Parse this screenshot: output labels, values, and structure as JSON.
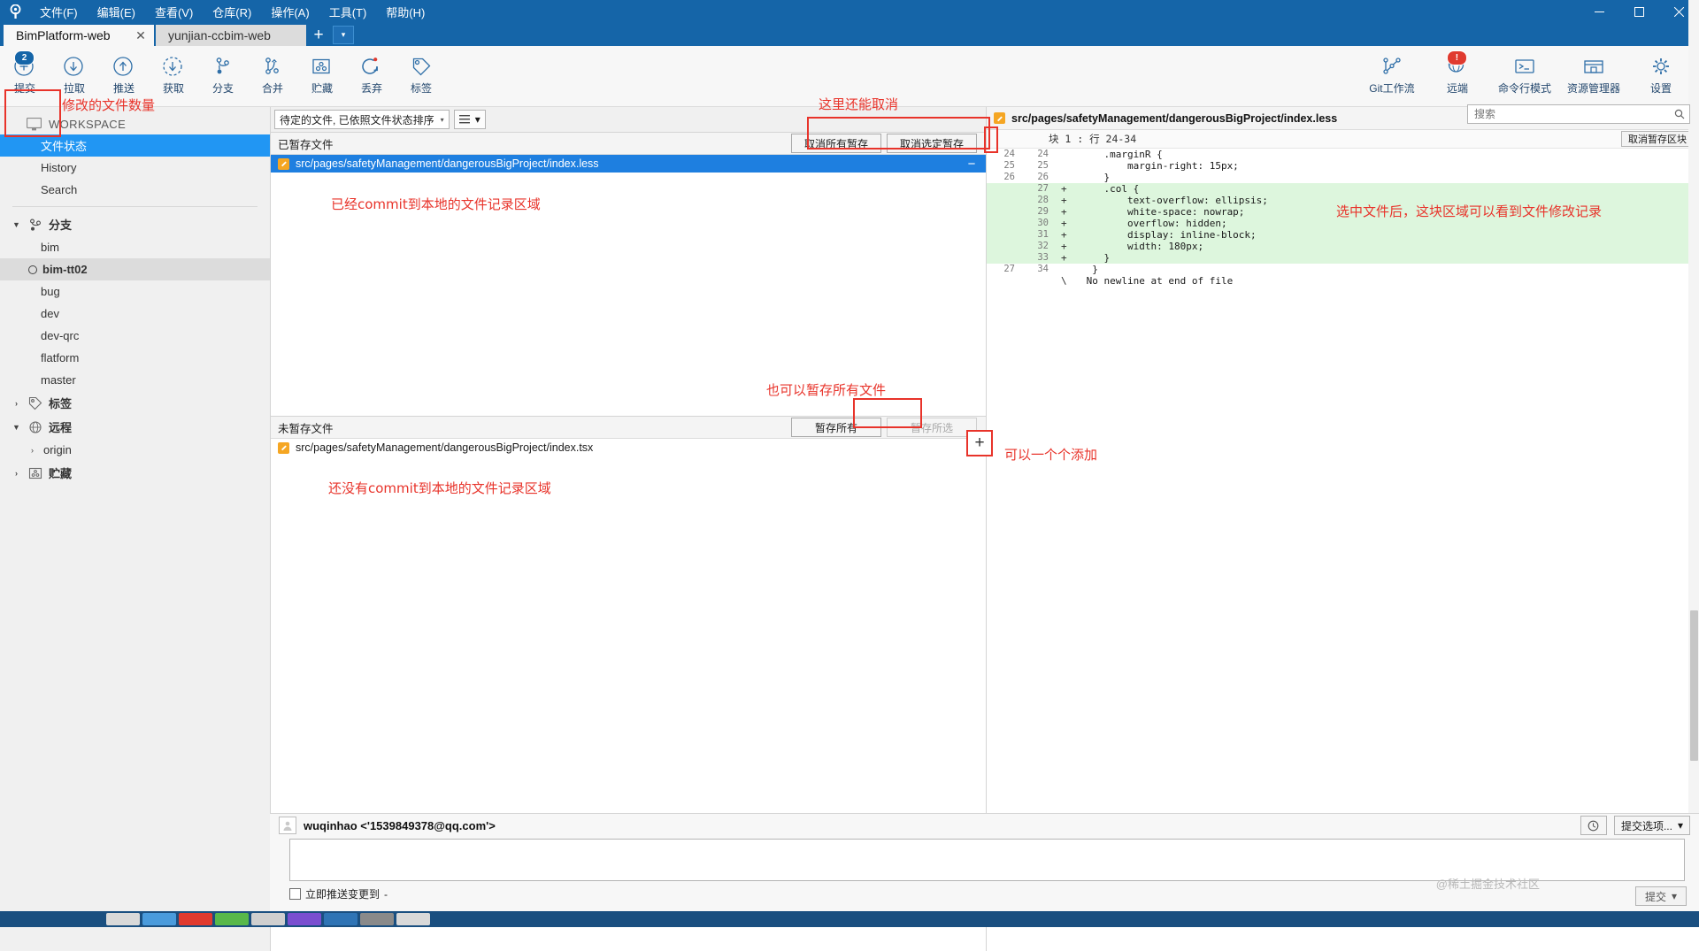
{
  "window": {
    "menus": [
      "文件(F)",
      "编辑(E)",
      "查看(V)",
      "仓库(R)",
      "操作(A)",
      "工具(T)",
      "帮助(H)"
    ],
    "controls": {
      "minimize": "minimize-icon",
      "maximize": "maximize-icon",
      "close": "close-icon"
    }
  },
  "tabs": {
    "items": [
      {
        "label": "BimPlatform-web",
        "active": true,
        "closable": true
      },
      {
        "label": "yunjian-ccbim-web",
        "active": false,
        "closable": false
      }
    ],
    "add_label": "+",
    "dropdown_label": "▾"
  },
  "toolbar": {
    "left": [
      {
        "label": "提交",
        "icon": "commit-plus-icon",
        "badge": "2",
        "badge_color": "#1565a8"
      },
      {
        "label": "拉取",
        "icon": "pull-down-icon",
        "badge": ""
      },
      {
        "label": "推送",
        "icon": "push-up-icon",
        "badge": ""
      },
      {
        "label": "获取",
        "icon": "fetch-dashed-icon",
        "badge": ""
      },
      {
        "label": "分支",
        "icon": "branch-icon",
        "badge": ""
      },
      {
        "label": "合并",
        "icon": "merge-icon",
        "badge": ""
      },
      {
        "label": "贮藏",
        "icon": "stash-icon",
        "badge": ""
      },
      {
        "label": "丢弃",
        "icon": "discard-refresh-icon",
        "badge": ""
      },
      {
        "label": "标签",
        "icon": "tag-icon",
        "badge": ""
      }
    ],
    "right": [
      {
        "label": "Git工作流",
        "icon": "gitflow-icon",
        "badge": ""
      },
      {
        "label": "远端",
        "icon": "remote-globe-icon",
        "badge": "!",
        "badge_color": "#e03a2f"
      },
      {
        "label": "命令行模式",
        "icon": "terminal-icon",
        "badge": ""
      },
      {
        "label": "资源管理器",
        "icon": "explorer-folder-icon",
        "badge": ""
      },
      {
        "label": "设置",
        "icon": "gear-icon",
        "badge": ""
      }
    ]
  },
  "search": {
    "placeholder": "搜索",
    "value": ""
  },
  "sidebar": {
    "workspace_label": "WORKSPACE",
    "workspace_items": [
      {
        "label": "文件状态",
        "selected": true
      },
      {
        "label": "History",
        "selected": false
      },
      {
        "label": "Search",
        "selected": false
      }
    ],
    "branches_group": {
      "label": "分支",
      "expanded": true,
      "caret": "▼"
    },
    "branches": [
      {
        "label": "bim",
        "current": false
      },
      {
        "label": "bim-tt02",
        "current": true
      },
      {
        "label": "bug",
        "current": false
      },
      {
        "label": "dev",
        "current": false
      },
      {
        "label": "dev-qrc",
        "current": false
      },
      {
        "label": "flatform",
        "current": false
      },
      {
        "label": "master",
        "current": false
      }
    ],
    "tags_group": {
      "label": "标签",
      "expanded": false,
      "caret": "›"
    },
    "remotes_group": {
      "label": "远程",
      "expanded": true,
      "caret": "▼"
    },
    "remotes": [
      {
        "label": "origin",
        "caret": "›"
      }
    ],
    "stash_group": {
      "label": "贮藏",
      "expanded": false,
      "caret": "›"
    }
  },
  "filter_bar": {
    "sort_label": "待定的文件, 已依照文件状态排序",
    "sort_caret": "▾",
    "view_icon": "list-view-icon",
    "view_caret": "▾"
  },
  "staged": {
    "header": "已暂存文件",
    "unstage_all_label": "取消所有暂存",
    "unstage_selected_label": "取消选定暂存",
    "files": [
      {
        "path": "src/pages/safetyManagement/dangerousBigProject/index.less",
        "selected": true,
        "icon": "modified-file-icon",
        "minus": "−"
      }
    ],
    "note": "已经commit到本地的文件记录区域"
  },
  "unstaged": {
    "header": "未暂存文件",
    "stage_all_label": "暂存所有",
    "stage_selected_label": "暂存所选",
    "files": [
      {
        "path": "src/pages/safetyManagement/dangerousBigProject/index.tsx",
        "selected": false,
        "icon": "modified-file-icon"
      }
    ],
    "note": "还没有commit到本地的文件记录区域"
  },
  "annotations": [
    {
      "id": "modified-count",
      "text": "修改的文件数量"
    },
    {
      "id": "can-cancel",
      "text": "这里还能取消"
    },
    {
      "id": "stage-all-note",
      "text": "也可以暂存所有文件"
    },
    {
      "id": "add-one-by-one",
      "text": "可以一个个添加"
    },
    {
      "id": "diff-note",
      "text": "选中文件后，这块区域可以看到文件修改记录"
    }
  ],
  "diff": {
    "file_icon": "modified-file-icon",
    "file_path": "src/pages/safetyManagement/dangerousBigProject/index.less",
    "gear_icon": "gear-icon",
    "gear_caret": "▾",
    "more_icon": "more-dots-icon",
    "hunk_label": "块 1 : 行 24-34",
    "unstage_hunk_label": "取消暂存区块",
    "lines": [
      {
        "old": "24",
        "new": "24",
        "sign": "",
        "text": "    .marginR {",
        "type": "context"
      },
      {
        "old": "25",
        "new": "25",
        "sign": "",
        "text": "        margin-right: 15px;",
        "type": "context"
      },
      {
        "old": "26",
        "new": "26",
        "sign": "",
        "text": "    }",
        "type": "context"
      },
      {
        "old": "",
        "new": "27",
        "sign": "+",
        "text": "    .col {",
        "type": "add"
      },
      {
        "old": "",
        "new": "28",
        "sign": "+",
        "text": "        text-overflow: ellipsis;",
        "type": "add"
      },
      {
        "old": "",
        "new": "29",
        "sign": "+",
        "text": "        white-space: nowrap;",
        "type": "add"
      },
      {
        "old": "",
        "new": "30",
        "sign": "+",
        "text": "        overflow: hidden;",
        "type": "add"
      },
      {
        "old": "",
        "new": "31",
        "sign": "+",
        "text": "        display: inline-block;",
        "type": "add"
      },
      {
        "old": "",
        "new": "32",
        "sign": "+",
        "text": "        width: 180px;",
        "type": "add"
      },
      {
        "old": "",
        "new": "33",
        "sign": "+",
        "text": "    }",
        "type": "add"
      },
      {
        "old": "27",
        "new": "34",
        "sign": "",
        "text": "  }",
        "type": "context"
      },
      {
        "old": "",
        "new": "",
        "sign": "\\",
        "text": " No newline at end of file",
        "type": "meta"
      }
    ]
  },
  "commit": {
    "author": "wuqinhao <'1539849378@qq.com'>",
    "avatar_icon": "user-avatar-icon",
    "history_icon": "clock-icon",
    "options_label": "提交选项...",
    "options_caret": "▾",
    "message": "",
    "push_checkbox_label": "立即推送变更到",
    "push_target": "-",
    "push_checked": false,
    "commit_button_label": "提交",
    "commit_button_caret": "▾"
  },
  "watermark": "@稀土掘金技术社区",
  "colors": {
    "title_blue": "#1565a8",
    "selection_blue": "#1e7fe0",
    "annotation_red": "#e8332a",
    "diff_add_green": "#ddf6dd",
    "file_icon_orange": "#f5a623"
  }
}
